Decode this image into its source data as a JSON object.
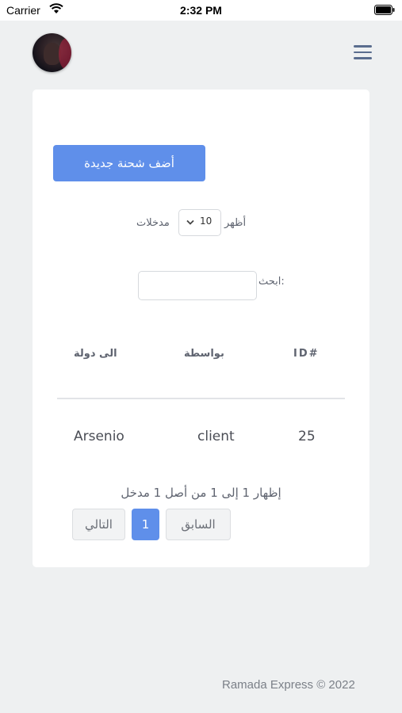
{
  "status_bar": {
    "carrier": "Carrier",
    "time": "2:32 PM"
  },
  "header": {
    "avatar_icon": "user-avatar",
    "menu_icon": "hamburger-menu-icon"
  },
  "main": {
    "add_button_label": "أضف شحنة جديدة",
    "show_label": "أظهر",
    "entries_select_value": "10",
    "entries_label": "مدخلات",
    "search_label": "ابحث:",
    "search_value": ""
  },
  "table": {
    "headers": {
      "id": "ID#",
      "by": "بواسطة",
      "country": "الى دولة"
    },
    "rows": [
      {
        "id": "25",
        "by": "client",
        "country": "Arsenio"
      }
    ]
  },
  "pagination": {
    "info": "إظهار 1 إلى 1 من أصل 1 مدخل",
    "previous": "السابق",
    "current_page": "1",
    "next": "التالي"
  },
  "footer": {
    "text": "Ramada Express © 2022"
  },
  "colors": {
    "accent": "#5f8fea",
    "background": "#eef0f1",
    "card": "#ffffff"
  }
}
